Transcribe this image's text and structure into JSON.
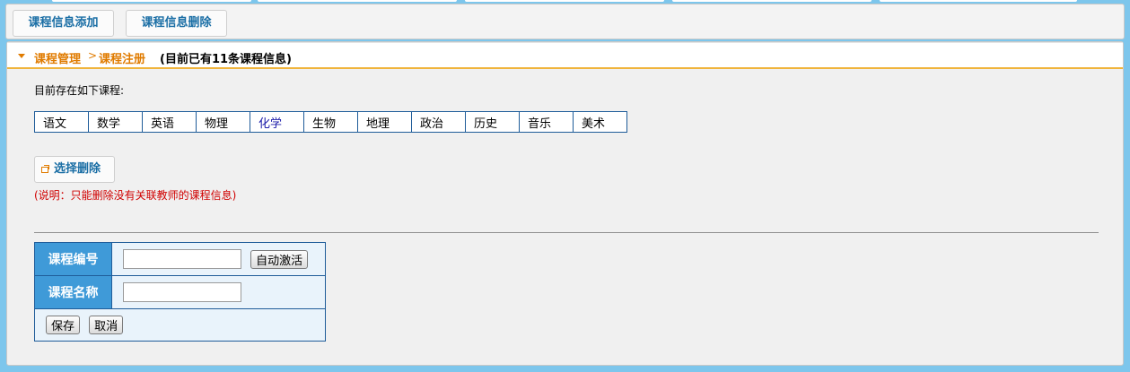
{
  "top_toolbar": {
    "add_label": "课程信息添加",
    "delete_label": "课程信息删除"
  },
  "breadcrumb": {
    "root": "课程管理",
    "separator": ">",
    "current": "课程注册",
    "count_info": "(目前已有11条课程信息)"
  },
  "course_section": {
    "intro": "目前存在如下课程:",
    "courses": [
      "语文",
      "数学",
      "英语",
      "物理",
      "化学",
      "生物",
      "地理",
      "政治",
      "历史",
      "音乐",
      "美术"
    ],
    "highlighted_course": "化学",
    "select_delete_label": "选择删除",
    "note": "(说明：只能删除没有关联教师的课程信息)"
  },
  "form": {
    "course_id_label": "课程编号",
    "course_id_value": "",
    "auto_activate_label": "自动激活",
    "course_name_label": "课程名称",
    "course_name_value": "",
    "save_label": "保存",
    "cancel_label": "取消"
  },
  "colors": {
    "page_background": "#7dc6ec",
    "accent_orange": "#e07b00",
    "label_blue": "#3f9ad8",
    "note_red": "#d00000"
  },
  "icons": {
    "title_arrow": "triangle-down-icon",
    "select_delete": "document-icon"
  }
}
